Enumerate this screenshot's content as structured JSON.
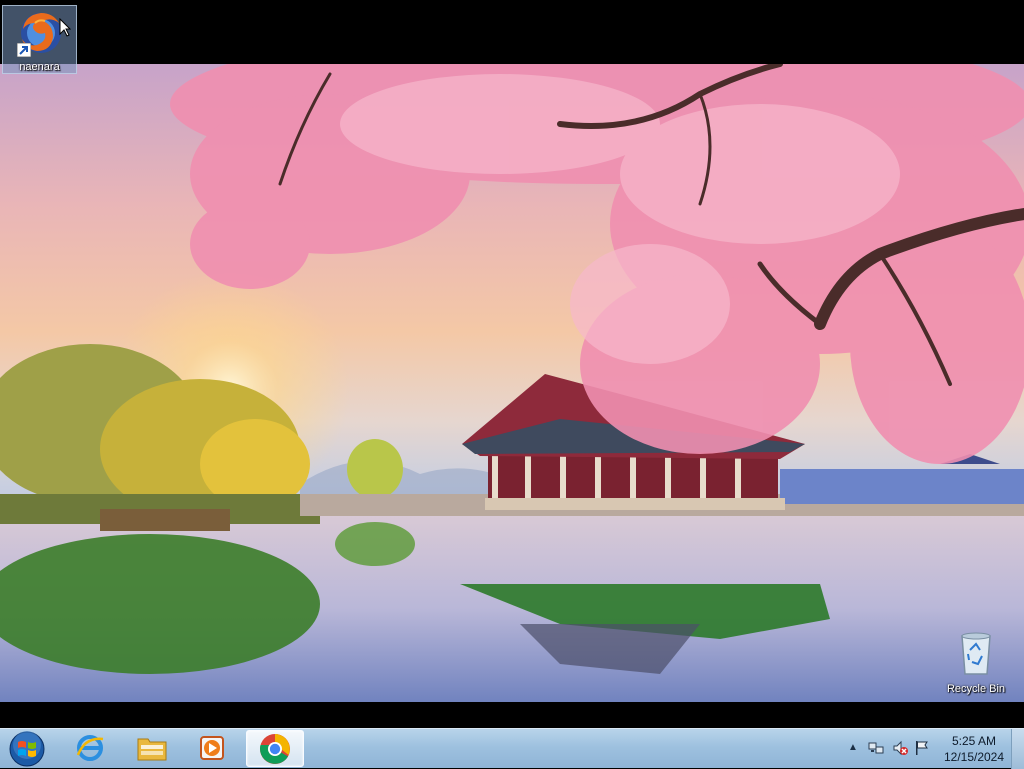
{
  "desktop": {
    "icons": [
      {
        "label": "naenara",
        "icon": "firefox-icon",
        "selected": true
      },
      {
        "label": "Recycle Bin",
        "icon": "recycle-bin-icon",
        "selected": false
      }
    ],
    "wallpaper": "cherry-blossom-pavilion-lake"
  },
  "taskbar": {
    "start": {
      "icon": "windows-logo-icon"
    },
    "pinned": [
      {
        "name": "Internet Explorer",
        "icon": "internet-explorer-icon"
      },
      {
        "name": "Windows Explorer",
        "icon": "folder-icon"
      },
      {
        "name": "Windows Media Player",
        "icon": "media-player-icon"
      },
      {
        "name": "Google Chrome",
        "icon": "chrome-icon",
        "active": true
      }
    ],
    "tray": {
      "arrow": "▲",
      "icons": [
        "network-icon",
        "volume-muted-icon",
        "action-center-flag-icon"
      ]
    },
    "clock": {
      "time": "5:25 AM",
      "date": "12/15/2024"
    }
  },
  "colors": {
    "taskbar": "#9ec1df",
    "accent": "#1f6fb5"
  }
}
